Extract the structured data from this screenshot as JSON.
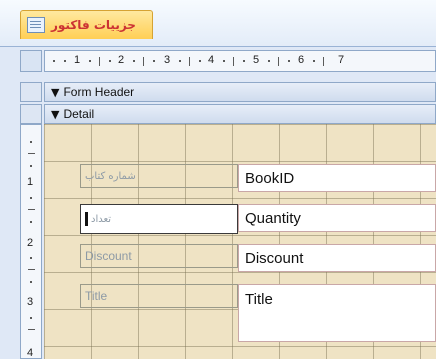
{
  "tab": {
    "title": "جزییات فاکتور",
    "icon": "form-icon"
  },
  "ruler": {
    "marks": [
      "1",
      "2",
      "3",
      "4",
      "5",
      "6",
      "7"
    ]
  },
  "sections": {
    "form_header": "Form Header",
    "detail": "Detail"
  },
  "vruler": {
    "marks": [
      "1",
      "2",
      "3",
      "4"
    ]
  },
  "fields": [
    {
      "label": "شماره کتاب",
      "value": "BookID"
    },
    {
      "label": "تعداد",
      "value": "Quantity"
    },
    {
      "label": "Discount",
      "value": "Discount"
    },
    {
      "label": "Title",
      "value": "Title"
    }
  ],
  "colors": {
    "tab": "#ffcf55",
    "canvas": "#efe3c4",
    "label_text": "#8d9aa6",
    "text_box": "#ffffff"
  }
}
